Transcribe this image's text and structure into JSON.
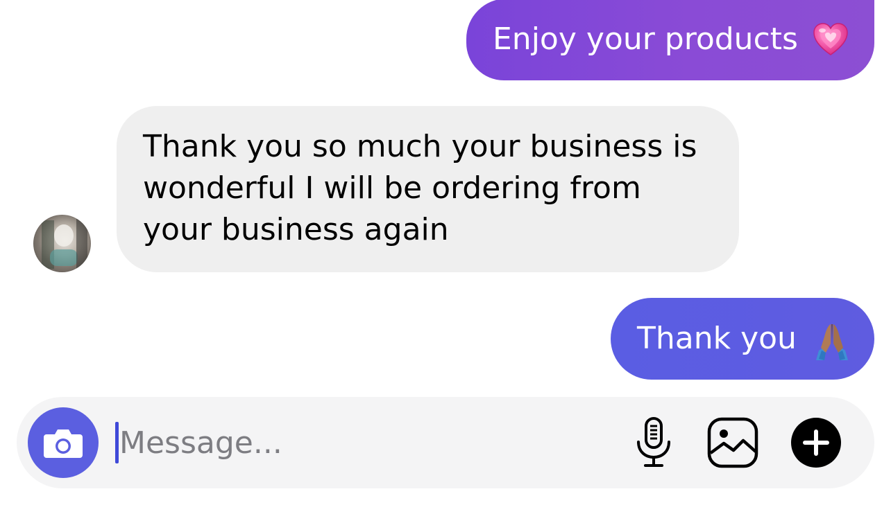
{
  "messages": [
    {
      "direction": "outgoing",
      "text": "Enjoy your products",
      "emoji": "💗",
      "emoji_name": "growing-heart-icon"
    },
    {
      "direction": "incoming",
      "text": "Thank you so much your business is wonderful I will be ordering from your business again"
    },
    {
      "direction": "outgoing",
      "text": "Thank you",
      "emoji": "🙏🏽",
      "emoji_name": "folded-hands-icon"
    }
  ],
  "composer": {
    "placeholder": "Message...",
    "value": "",
    "icons": [
      "camera-icon",
      "microphone-icon",
      "image-icon",
      "plus-icon"
    ]
  },
  "colors": {
    "outgoing_bubble_1": "#8049d8",
    "outgoing_bubble_2": "#5d5de2",
    "incoming_bubble": "#efefef",
    "camera_button": "#5b5fe0",
    "composer_background": "#f4f4f5"
  }
}
